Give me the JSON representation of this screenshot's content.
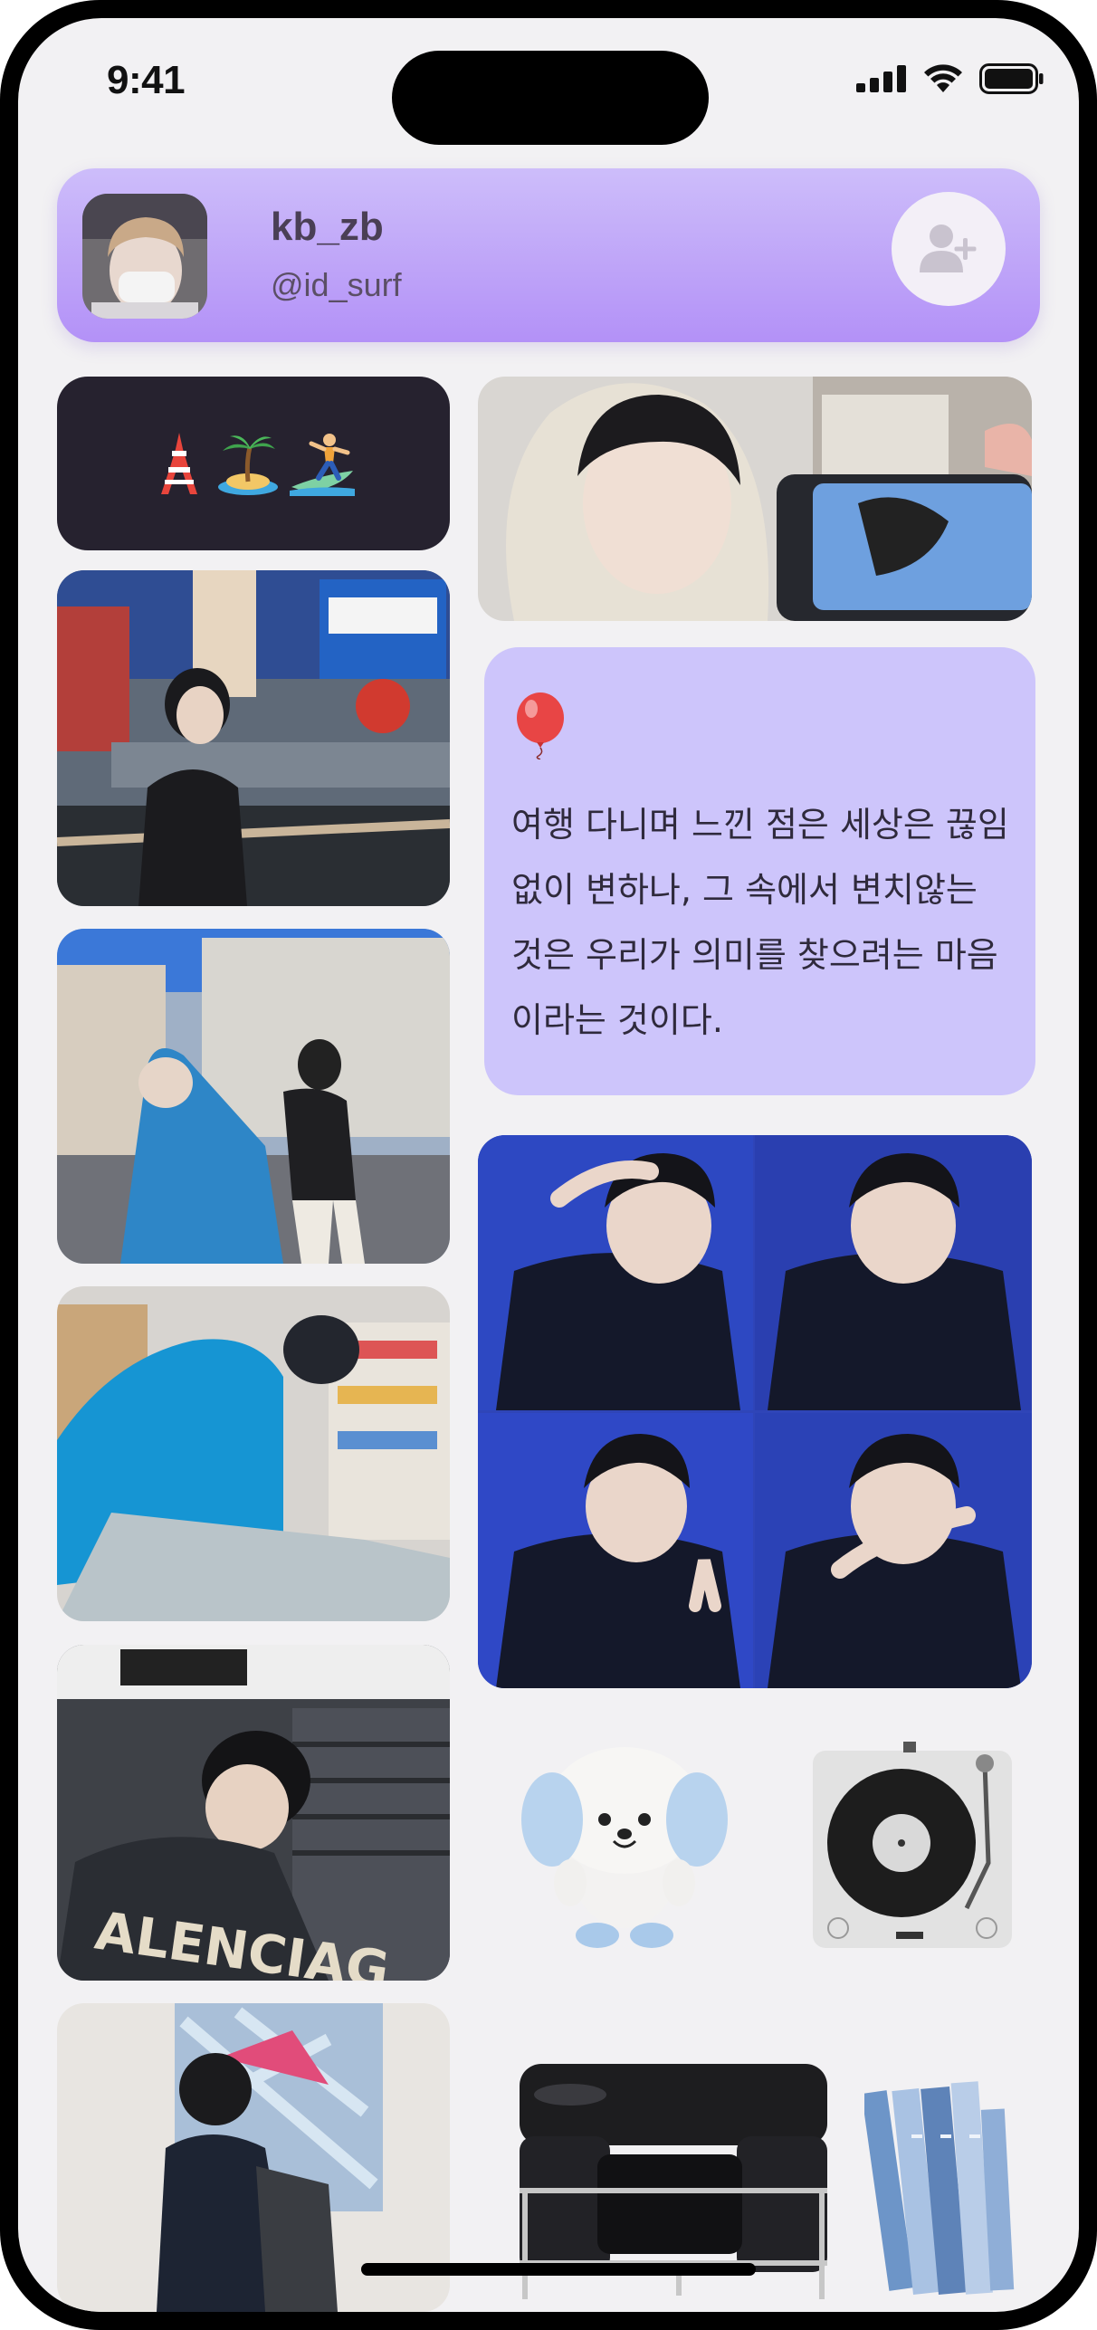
{
  "status_bar": {
    "time": "9:41"
  },
  "profile": {
    "name": "kb_zb",
    "handle": "@id_surf"
  },
  "emoji_tile": {
    "emojis": [
      "tokyo-tower",
      "desert-island",
      "surfer"
    ]
  },
  "quote": {
    "text": "여행 다니며 느낀 점은 세상은 끊임없이 변하나, 그 속에서 변치않는 것은 우리가 의미를 찾으려는 마음이라는 것이다."
  },
  "colors": {
    "profile_gradient_top": "#cdbdfa",
    "profile_gradient_bottom": "#b391f7",
    "quote_card": "#cdc5fb",
    "emoji_tile_bg": "#26222f",
    "screen_bg": "#f2f1f3"
  },
  "icons": {
    "follow": "add-person-icon",
    "signal": "cellular-signal-icon",
    "wifi": "wifi-icon",
    "battery": "battery-icon"
  }
}
